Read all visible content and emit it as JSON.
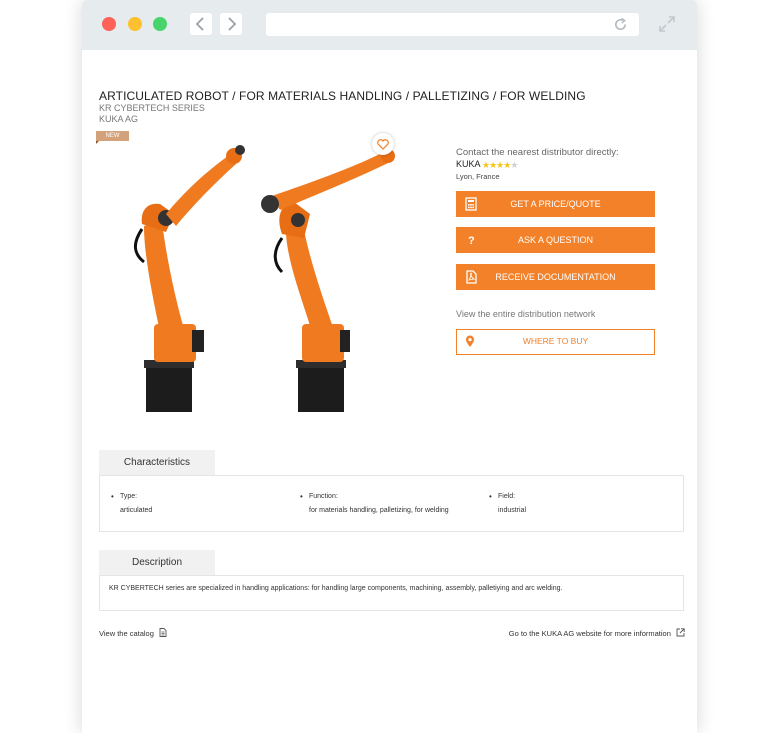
{
  "product": {
    "title": "ARTICULATED ROBOT / FOR MATERIALS HANDLING / PALLETIZING / FOR WELDING",
    "series": "KR CYBERTECH SERIES",
    "manufacturer": "KUKA AG",
    "badge": "NEW"
  },
  "distributor": {
    "contact_text": "Contact the nearest distributor directly:",
    "name": "KUKA",
    "rating_stars": 4,
    "rating_max": 5,
    "location": "Lyon, France"
  },
  "actions": {
    "price_quote": "GET A PRICE/QUOTE",
    "ask_question": "ASK A QUESTION",
    "documentation": "RECEIVE DOCUMENTATION",
    "network_text": "View the entire distribution network",
    "where_to_buy": "WHERE TO BUY"
  },
  "characteristics": {
    "tab_label": "Characteristics",
    "items": [
      {
        "label": "Type:",
        "value": "articulated"
      },
      {
        "label": "Function:",
        "value": "for materials handling, palletizing, for welding"
      },
      {
        "label": "Field:",
        "value": "industrial"
      }
    ]
  },
  "description": {
    "tab_label": "Description",
    "text": "KR CYBERTECH series are specialized in handling applications: for handling large components, machining, assembly, palletiying and arc welding."
  },
  "footer": {
    "catalog_link": "View the catalog",
    "website_link": "Go to the KUKA AG website for more information"
  },
  "colors": {
    "accent": "#f28129",
    "badge": "#d4a27a",
    "star": "#f5c518",
    "chrome": "#e6ebee"
  }
}
